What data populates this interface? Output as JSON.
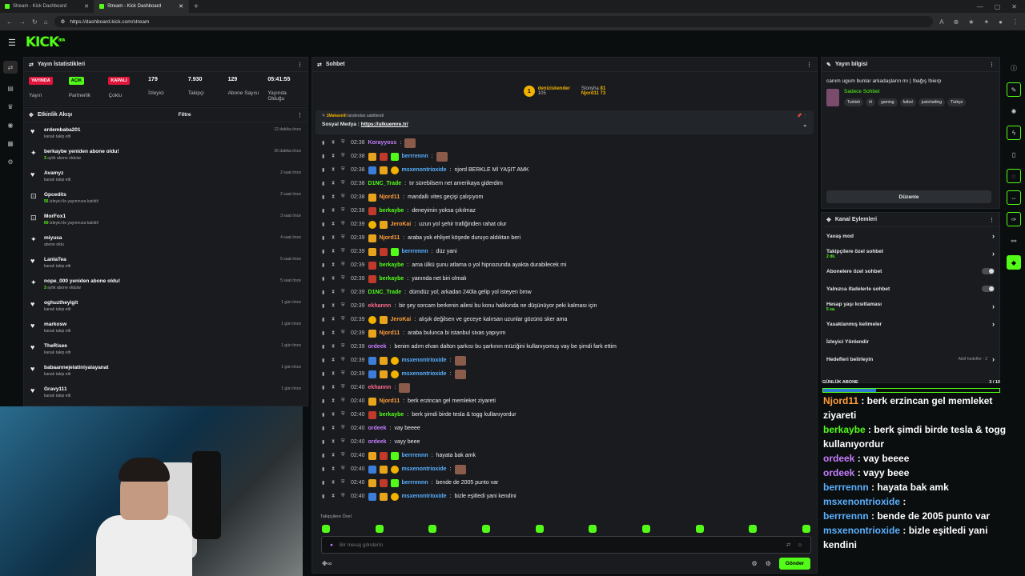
{
  "browser": {
    "tabs": [
      {
        "label": "Stream - Kick Dashboard",
        "active": false
      },
      {
        "label": "Stream - Kick Dashboard",
        "active": true
      }
    ],
    "url": "https://dashboard.kick.com/stream"
  },
  "brand": {
    "logo": "KICK",
    "logo_sup": "BETA",
    "accent": "#53fc18"
  },
  "stats": {
    "title": "Yayın İstatistikleri",
    "items": [
      {
        "badge": "YAYINDA",
        "label": "Yayın"
      },
      {
        "badge": "AÇIK",
        "label": "Partnerlik"
      },
      {
        "badge": "KAPALI",
        "label": "Çoklu"
      },
      {
        "value": "179",
        "label": "İzleyici"
      },
      {
        "value": "7.930",
        "label": "Takipçi"
      },
      {
        "value": "129",
        "label": "Abone Sayısı"
      },
      {
        "value": "05:41:55",
        "label": "Yayında Olduğu"
      }
    ]
  },
  "events": {
    "title": "Etkinlik Akışı",
    "filter": "Filtre",
    "items": [
      {
        "icon": "heart-icon",
        "name": "erdembaba201",
        "sub": "kanalı takip etti",
        "time": "12 dakika önce"
      },
      {
        "icon": "star-icon",
        "name": "berkaybe yeniden abone oldu!",
        "sub_hl": "3",
        "sub": " aylık abone oldular",
        "time": "26 dakika önce"
      },
      {
        "icon": "heart-icon",
        "name": "Avamyz",
        "sub": "kanalı takip etti",
        "time": "2 saat önce"
      },
      {
        "icon": "host-icon",
        "name": "Gpcedits",
        "sub_hl": "56",
        "sub": " izleyici ile yayınınıza katıldı!",
        "time": "2 saat önce"
      },
      {
        "icon": "host-icon",
        "name": "MorFox1",
        "sub_hl": "60",
        "sub": " izleyici ile yayınınıza katıldı!",
        "time": "3 saat önce"
      },
      {
        "icon": "star-icon",
        "name": "miyusa",
        "sub": "abone oldu",
        "time": "4 saat önce"
      },
      {
        "icon": "heart-icon",
        "name": "LanlaTea",
        "sub": "kanalı takip etti",
        "time": "5 saat önce"
      },
      {
        "icon": "star-icon",
        "name": "nope_000 yeniden abone oldu!",
        "sub_hl": "3",
        "sub": " aylık abone oldular",
        "time": "5 saat önce"
      },
      {
        "icon": "heart-icon",
        "name": "oghuztheyigit",
        "sub": "kanalı takip etti",
        "time": "1 gün önce"
      },
      {
        "icon": "heart-icon",
        "name": "markosw",
        "sub": "kanalı takip etti",
        "time": "1 gün önce"
      },
      {
        "icon": "heart-icon",
        "name": "TheRisee",
        "sub": "kanalı takip etti",
        "time": "1 gün önce"
      },
      {
        "icon": "heart-icon",
        "name": "babaannejelatiniyalayanat",
        "sub": "kanalı takip etti",
        "time": "1 gün önce"
      },
      {
        "icon": "heart-icon",
        "name": "Gravy111",
        "sub": "kanalı takip etti",
        "time": "1 gün önce"
      }
    ]
  },
  "chat": {
    "title": "Sohbet",
    "leaders": {
      "first": {
        "name": "deniziskender",
        "level": "1",
        "count": "105"
      },
      "second": {
        "name": "Stonyha",
        "count": "81"
      },
      "third": {
        "name": "Njord11",
        "count": "73"
      }
    },
    "pinned": {
      "by": "1Makavelli",
      "by_suffix": " tarafından sabitlendi",
      "text": "Sosyal Medya : ",
      "link": "https://ulkuemre.tr/"
    },
    "messages": [
      {
        "time": "02:38",
        "user": "Korayyoss",
        "color": "#c77dff",
        "text": "",
        "emote": true,
        "badges": []
      },
      {
        "time": "02:38",
        "user": "berrrennn",
        "color": "#5ab0ff",
        "text": "",
        "emote": true,
        "badges": [
          "b2",
          "b5",
          "b4"
        ]
      },
      {
        "time": "02:38",
        "user": "msxenontrioxide",
        "color": "#5ab0ff",
        "text": "njord BERKLE Mİ YAŞIT AMK",
        "emote": false,
        "badges": [
          "b1",
          "b2",
          "b3"
        ]
      },
      {
        "time": "02:38",
        "user": "D1NC_Trade",
        "color": "#53fc18",
        "text": "tır sürebilsem net amerikaya giderdim",
        "emote": false,
        "badges": []
      },
      {
        "time": "02:38",
        "user": "Njord11",
        "color": "#ff9d3b",
        "text": "mandallı vites geçişi çalışıyom",
        "emote": false,
        "badges": [
          "b2"
        ]
      },
      {
        "time": "02:38",
        "user": "berkaybe",
        "color": "#53fc18",
        "text": "deneyimin yoksa çıkılmaz",
        "emote": false,
        "badges": [
          "b5"
        ]
      },
      {
        "time": "02:39",
        "user": "JeroKai",
        "color": "#ff9d3b",
        "text": "uzun yol şehir trafiğinden rahat olur",
        "emote": false,
        "badges": [
          "b3",
          "b2"
        ]
      },
      {
        "time": "02:39",
        "user": "Njord11",
        "color": "#ff9d3b",
        "text": "araba yok ehliyet köşede duruyo aldıktan beri",
        "emote": false,
        "badges": [
          "b2"
        ]
      },
      {
        "time": "02:39",
        "user": "berrrennn",
        "color": "#5ab0ff",
        "text": "düz yani",
        "emote": false,
        "badges": [
          "b2",
          "b5",
          "b4"
        ]
      },
      {
        "time": "02:39",
        "user": "berkaybe",
        "color": "#53fc18",
        "text": "ama ülkü şunu atlama o yol hipnozunda ayakta durabilecek mi",
        "emote": false,
        "badges": [
          "b5"
        ]
      },
      {
        "time": "02:39",
        "user": "berkaybe",
        "color": "#53fc18",
        "text": "yanında net biri olmalı",
        "emote": false,
        "badges": [
          "b5"
        ]
      },
      {
        "time": "02:39",
        "user": "D1NC_Trade",
        "color": "#53fc18",
        "text": "dümdüz yol; arkadan 240la gelip yol isteyen bmw",
        "emote": false,
        "badges": []
      },
      {
        "time": "02:39",
        "user": "ekhannn",
        "color": "#ff6b8b",
        "text": "bir şey sorcam berkenin ailesi bu konu hakkında ne düşünüyor peki kalması için",
        "emote": false,
        "badges": []
      },
      {
        "time": "02:39",
        "user": "JeroKai",
        "color": "#ff9d3b",
        "text": "alışık değilsen ve geceye kalırsan uzunlar gözünü sker ama",
        "emote": false,
        "badges": [
          "b3",
          "b2"
        ]
      },
      {
        "time": "02:39",
        "user": "Njord11",
        "color": "#ff9d3b",
        "text": "araba bulunca bi istanbul sivas yapıyım",
        "emote": false,
        "badges": [
          "b2"
        ]
      },
      {
        "time": "02:39",
        "user": "ordeek",
        "color": "#c77dff",
        "text": "benim adım elvan dalton şarkısı bu şarkının müziğini kullanıyomuş vay be şimdi fark ettim",
        "emote": false,
        "badges": []
      },
      {
        "time": "02:39",
        "user": "msxenontrioxide",
        "color": "#5ab0ff",
        "text": "",
        "emote": true,
        "badges": [
          "b1",
          "b2",
          "b3"
        ]
      },
      {
        "time": "02:39",
        "user": "msxenontrioxide",
        "color": "#5ab0ff",
        "text": "",
        "emote": true,
        "badges": [
          "b1",
          "b2",
          "b3"
        ]
      },
      {
        "time": "02:40",
        "user": "ekhannn",
        "color": "#ff6b8b",
        "text": "",
        "emote": true,
        "badges": []
      },
      {
        "time": "02:40",
        "user": "Njord11",
        "color": "#ff9d3b",
        "text": "berk erzincan gel memleket ziyareti",
        "emote": false,
        "badges": [
          "b2"
        ]
      },
      {
        "time": "02:40",
        "user": "berkaybe",
        "color": "#53fc18",
        "text": "berk şimdi birde tesla & togg kullanıyordur",
        "emote": false,
        "badges": [
          "b5"
        ]
      },
      {
        "time": "02:40",
        "user": "ordeek",
        "color": "#c77dff",
        "text": "vay beeee",
        "emote": false,
        "badges": []
      },
      {
        "time": "02:40",
        "user": "ordeek",
        "color": "#c77dff",
        "text": "vayy beee",
        "emote": false,
        "badges": []
      },
      {
        "time": "02:40",
        "user": "berrrennn",
        "color": "#5ab0ff",
        "text": "hayata bak amk",
        "emote": false,
        "badges": [
          "b2",
          "b5",
          "b4"
        ]
      },
      {
        "time": "02:40",
        "user": "msxenontrioxide",
        "color": "#5ab0ff",
        "text": "",
        "emote": true,
        "badges": [
          "b1",
          "b2",
          "b3"
        ]
      },
      {
        "time": "02:40",
        "user": "berrrennn",
        "color": "#5ab0ff",
        "text": "bende de 2005 punto var",
        "emote": false,
        "badges": [
          "b2",
          "b5",
          "b4"
        ]
      },
      {
        "time": "02:40",
        "user": "msxenontrioxide",
        "color": "#5ab0ff",
        "text": "bizle eşitledi yani kendini",
        "emote": false,
        "badges": [
          "b1",
          "b2",
          "b3"
        ]
      }
    ],
    "followers_only": "Takipçilere Özel",
    "input_placeholder": "Bir mesaj gönderin",
    "send_label": "Gönder"
  },
  "stream_info": {
    "title_label": "Yayın bilgisi",
    "stream_title": "canım ugum bunlar arkadaşların mı | !bağış !bierp",
    "category": "Sadece Sohbet",
    "tags": [
      "Turkish",
      "irl",
      "gaming",
      "futbol",
      "justchatting",
      "Türkçe"
    ],
    "edit_label": "Düzenle"
  },
  "channel_actions": {
    "title": "Kanal Eylemleri",
    "items": [
      {
        "label": "Yavaş mod",
        "type": "chevron"
      },
      {
        "label": "Takipçilere özel sohbet",
        "sub": "2 dk.",
        "type": "chevron"
      },
      {
        "label": "Abonelere özel sohbet",
        "type": "toggle"
      },
      {
        "label": "Yalnızca ifadelerle sohbet",
        "type": "toggle"
      },
      {
        "label": "Hesap yaşı kısıtlaması",
        "sub": "5 sa.",
        "type": "chevron"
      },
      {
        "label": "Yasaklanmış kelimeler",
        "type": "chevron"
      },
      {
        "label": "İzleyici Yönlendir",
        "type": "none"
      },
      {
        "label": "Hedefleri belirleyin",
        "extra": "Aktif hedefler - 2",
        "type": "chevron"
      }
    ]
  },
  "daily_sub": {
    "label": "GÜNLÜK ABONE",
    "count": "3 / 10",
    "progress": 0.3
  },
  "overlay_chat": [
    {
      "user": "Njord11",
      "color": "#ff9d3b",
      "text": " : berk erzincan gel memleket ziyareti"
    },
    {
      "user": "berkaybe",
      "color": "#53fc18",
      "text": " : berk şimdi birde tesla & togg kullanıyordur"
    },
    {
      "user": "ordeek",
      "color": "#c77dff",
      "text": " : vay beeee"
    },
    {
      "user": "ordeek",
      "color": "#c77dff",
      "text": " : vayy beee"
    },
    {
      "user": "berrrennn",
      "color": "#5ab0ff",
      "text": " : hayata bak amk"
    },
    {
      "user": "msxenontrioxide",
      "color": "#5ab0ff",
      "text": " :"
    },
    {
      "user": "berrrennn",
      "color": "#5ab0ff",
      "text": " : bende de 2005 punto var"
    },
    {
      "user": "msxenontrioxide",
      "color": "#5ab0ff",
      "text": " : bizle eşitledi yani kendini"
    }
  ]
}
